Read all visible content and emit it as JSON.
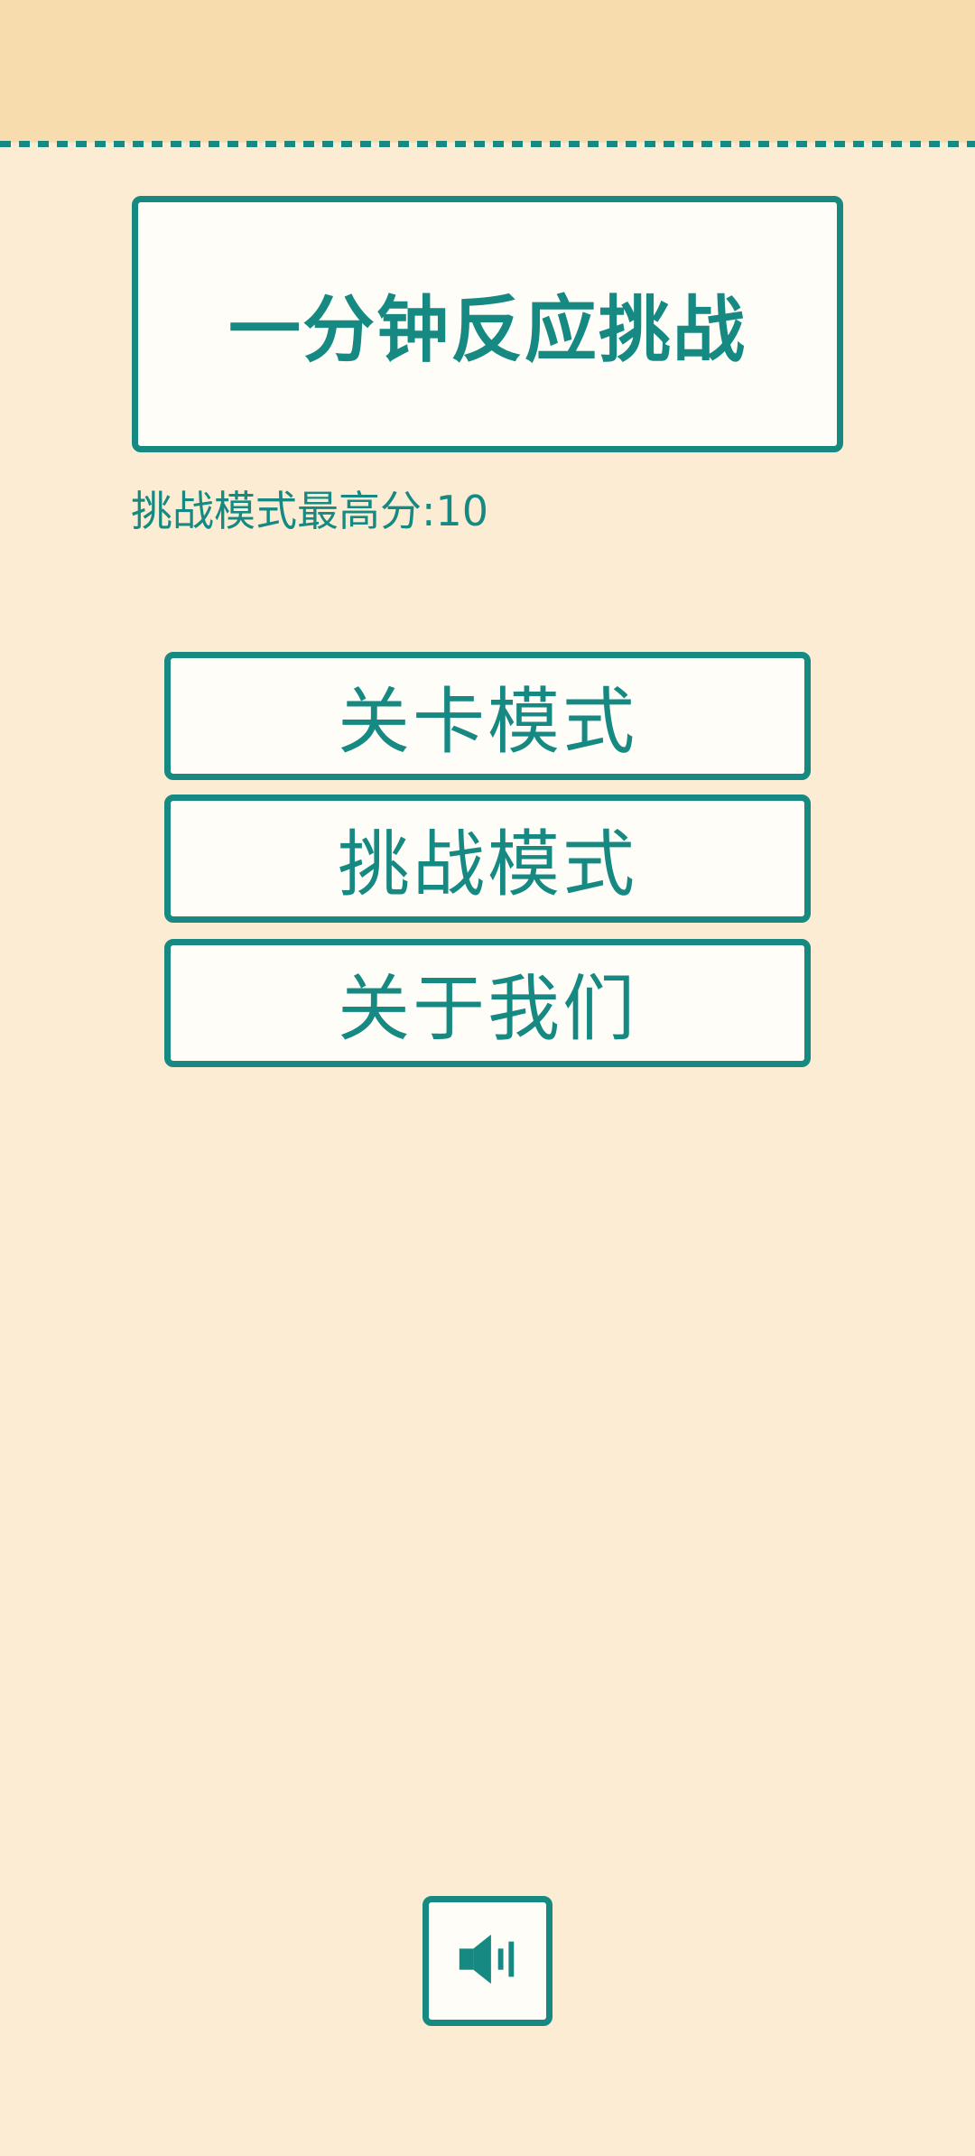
{
  "title": "一分钟反应挑战",
  "high_score": {
    "text": "挑战模式最高分:10",
    "value": 10
  },
  "menu": {
    "level_mode": "关卡模式",
    "challenge_mode": "挑战模式",
    "about_us": "关于我们"
  },
  "sound_button": {
    "icon": "speaker-icon"
  },
  "colors": {
    "background": "#fcecd3",
    "top_band": "#f7dcae",
    "accent": "#168a82",
    "panel": "#fffdf7"
  }
}
